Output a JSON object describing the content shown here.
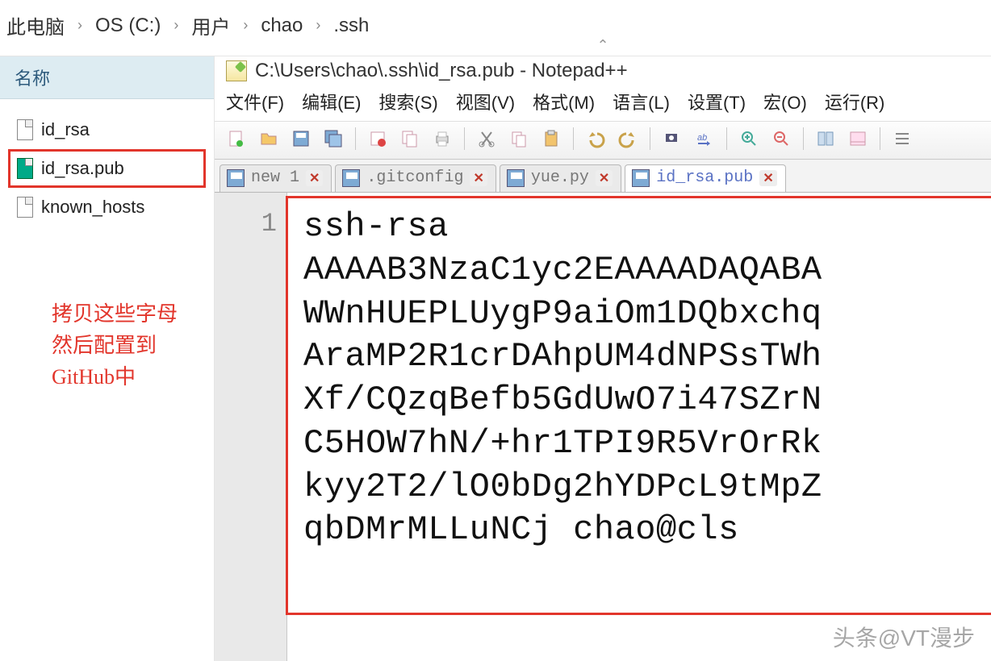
{
  "breadcrumb": {
    "items": [
      "此电脑",
      "OS (C:)",
      "用户",
      "chao",
      ".ssh"
    ],
    "sep": "›"
  },
  "file_pane": {
    "header": "名称",
    "files": [
      {
        "name": "id_rsa",
        "selected": false,
        "kind": "file"
      },
      {
        "name": "id_rsa.pub",
        "selected": true,
        "kind": "pub"
      },
      {
        "name": "known_hosts",
        "selected": false,
        "kind": "file"
      }
    ]
  },
  "annotation": {
    "line1": "拷贝这些字母",
    "line2": "然后配置到",
    "line3": "GitHub中"
  },
  "notepad": {
    "title": "C:\\Users\\chao\\.ssh\\id_rsa.pub - Notepad++",
    "menus": [
      "文件(F)",
      "编辑(E)",
      "搜索(S)",
      "视图(V)",
      "格式(M)",
      "语言(L)",
      "设置(T)",
      "宏(O)",
      "运行(R)"
    ],
    "tabs": [
      {
        "label": "new 1",
        "active": false
      },
      {
        "label": ".gitconfig",
        "active": false
      },
      {
        "label": "yue.py",
        "active": false
      },
      {
        "label": "id_rsa.pub",
        "active": true
      }
    ],
    "gutter": {
      "line1": "1"
    },
    "content": {
      "l1": "ssh-rsa",
      "l2": "AAAAB3NzaC1yc2EAAAADAQABA",
      "l3": "WWnHUEPLUygP9aiOm1DQbxchq",
      "l4": "AraMP2R1crDAhpUM4dNPSsTWh",
      "l5": "Xf/CQzqBefb5GdUwO7i47SZrN",
      "l6": "C5HOW7hN/+hr1TPI9R5VrOrRk",
      "l7": "kyy2T2/lO0bDg2hYDPcL9tMpZ",
      "l8": "qbDMrMLLuNCj chao@cls"
    },
    "toolbar_icons": [
      "new-file-icon",
      "open-icon",
      "save-icon",
      "save-all-icon",
      "close-icon",
      "copy-all-icon",
      "print-icon",
      "cut-icon",
      "copy-icon",
      "paste-icon",
      "undo-icon",
      "redo-icon",
      "find-icon",
      "replace-icon",
      "zoom-in-icon",
      "zoom-out-icon",
      "wrap-icon",
      "show-all-icon",
      "list-icon"
    ]
  },
  "watermark": "头条@VT漫步"
}
